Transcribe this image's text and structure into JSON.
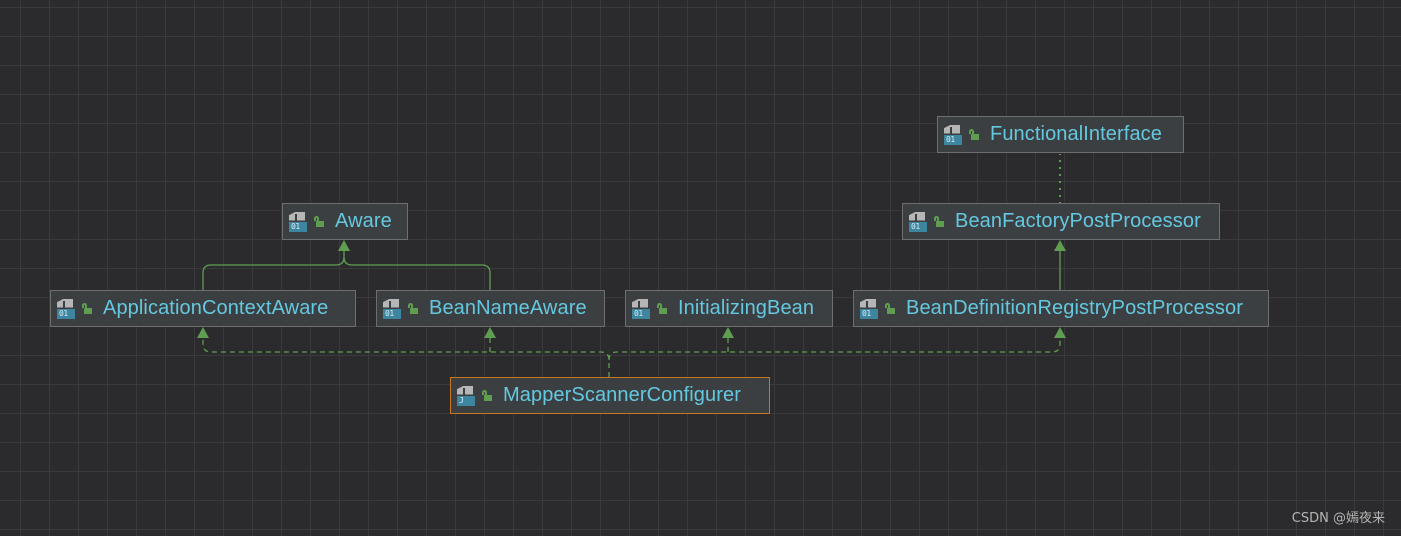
{
  "diagram": {
    "nodes": [
      {
        "id": "functional-interface",
        "label": "FunctionalInterface",
        "icon_text": "01",
        "kind": "interface"
      },
      {
        "id": "aware",
        "label": "Aware",
        "icon_text": "01",
        "kind": "interface"
      },
      {
        "id": "bean-factory-post-processor",
        "label": "BeanFactoryPostProcessor",
        "icon_text": "01",
        "kind": "interface"
      },
      {
        "id": "application-context-aware",
        "label": "ApplicationContextAware",
        "icon_text": "01",
        "kind": "interface"
      },
      {
        "id": "bean-name-aware",
        "label": "BeanNameAware",
        "icon_text": "01",
        "kind": "interface"
      },
      {
        "id": "initializing-bean",
        "label": "InitializingBean",
        "icon_text": "01",
        "kind": "interface"
      },
      {
        "id": "bean-definition-registry-post-processor",
        "label": "BeanDefinitionRegistryPostProcessor",
        "icon_text": "01",
        "kind": "interface"
      },
      {
        "id": "mapper-scanner-configurer",
        "label": "MapperScannerConfigurer",
        "icon_text": "J",
        "kind": "class",
        "selected": true
      }
    ],
    "relations": [
      {
        "from": "application-context-aware",
        "to": "aware",
        "type": "extends"
      },
      {
        "from": "bean-name-aware",
        "to": "aware",
        "type": "extends"
      },
      {
        "from": "bean-definition-registry-post-processor",
        "to": "bean-factory-post-processor",
        "type": "extends"
      },
      {
        "from": "bean-factory-post-processor",
        "to": "functional-interface",
        "type": "annotated-with"
      },
      {
        "from": "mapper-scanner-configurer",
        "to": "application-context-aware",
        "type": "implements"
      },
      {
        "from": "mapper-scanner-configurer",
        "to": "bean-name-aware",
        "type": "implements"
      },
      {
        "from": "mapper-scanner-configurer",
        "to": "initializing-bean",
        "type": "implements"
      },
      {
        "from": "mapper-scanner-configurer",
        "to": "bean-definition-registry-post-processor",
        "type": "implements"
      }
    ],
    "colors": {
      "background": "#2b2b2d",
      "grid": "#3a3a3c",
      "node_fill": "#3c3f41",
      "node_border": "#6e6e6e",
      "selected_border": "#c7771f",
      "label": "#64c8e0",
      "edge": "#5f9e50"
    }
  },
  "watermark": "CSDN @嫣夜来"
}
